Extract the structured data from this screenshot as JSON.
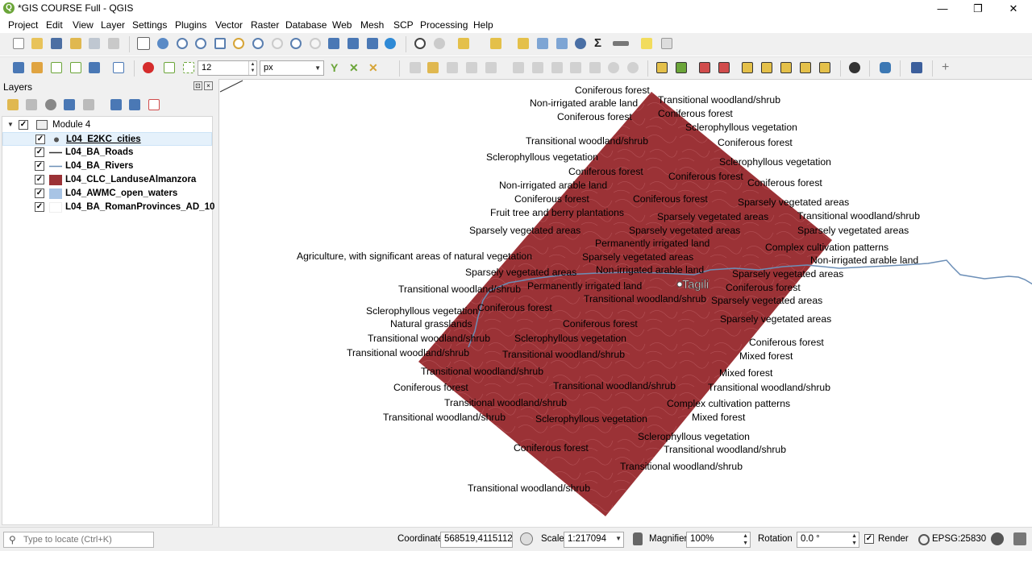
{
  "window": {
    "title": "*GIS COURSE Full - QGIS",
    "minimize": "—",
    "restore": "❐",
    "close": "✕"
  },
  "menu": [
    "Project",
    "Edit",
    "View",
    "Layer",
    "Settings",
    "Plugins",
    "Vector",
    "Raster",
    "Database",
    "Web",
    "Mesh",
    "SCP",
    "Processing",
    "Help"
  ],
  "toolbar2": {
    "symbol_size": "12",
    "unit": "px"
  },
  "layers_panel": {
    "title": "Layers",
    "group": "Module 4",
    "layers": [
      {
        "name": "L04_E2KC_cities",
        "symbol": "point"
      },
      {
        "name": "L04_BA_Roads",
        "symbol": "line-dark"
      },
      {
        "name": "L04_BA_Rivers",
        "symbol": "line-blue"
      },
      {
        "name": "L04_CLC_LanduseAlmanzora",
        "symbol": "fill-red"
      },
      {
        "name": "L04_AWMC_open_waters",
        "symbol": "fill-lightblue"
      },
      {
        "name": "L04_BA_RomanProvinces_AD_100",
        "symbol": "fill-empty"
      }
    ]
  },
  "colors": {
    "landuse_fill": "#9b3236",
    "river": "#6c8fb7",
    "qgis_green": "#6ba539"
  },
  "map": {
    "city_label": "Tagili",
    "labels": [
      "Coniferous forest",
      "Non-irrigated arable land",
      "Transitional woodland/shrub",
      "Coniferous forest",
      "Coniferous forest",
      "Sclerophyllous vegetation",
      "Transitional woodland/shrub",
      "Coniferous forest",
      "Sclerophyllous vegetation",
      "Sclerophyllous vegetation",
      "Coniferous forest",
      "Coniferous forest",
      "Non-irrigated arable land",
      "Coniferous forest",
      "Coniferous forest",
      "Coniferous forest",
      "Sparsely vegetated areas",
      "Fruit tree and berry plantations",
      "Sparsely vegetated areas",
      "Transitional woodland/shrub",
      "Sparsely vegetated areas",
      "Sparsely vegetated areas",
      "Sparsely vegetated areas",
      "Permanently irrigated land",
      "Complex cultivation patterns",
      "Agriculture, with significant areas of natural vegetation",
      "Sparsely vegetated areas",
      "Non-irrigated arable land",
      "Non-irrigated arable land",
      "Sparsely vegetated areas",
      "Sparsely vegetated areas",
      "Transitional woodland/shrub",
      "Permanently irrigated land",
      "Coniferous forest",
      "Transitional woodland/shrub",
      "Sparsely vegetated areas",
      "Sclerophyllous vegetation",
      "Coniferous forest",
      "Natural grasslands",
      "Coniferous forest",
      "Sparsely vegetated areas",
      "Transitional woodland/shrub",
      "Sclerophyllous vegetation",
      "Coniferous forest",
      "Transitional woodland/shrub",
      "Transitional woodland/shrub",
      "Mixed forest",
      "Transitional woodland/shrub",
      "Mixed forest",
      "Coniferous forest",
      "Transitional woodland/shrub",
      "Transitional woodland/shrub",
      "Transitional woodland/shrub",
      "Complex cultivation patterns",
      "Transitional woodland/shrub",
      "Sclerophyllous vegetation",
      "Mixed forest",
      "Sclerophyllous vegetation",
      "Coniferous forest",
      "Transitional woodland/shrub",
      "Transitional woodland/shrub",
      "Transitional woodland/shrub"
    ]
  },
  "statusbar": {
    "locate_placeholder": "Type to locate (Ctrl+K)",
    "coordinate_label": "Coordinate",
    "coordinate": "568519,4115112",
    "scale_label": "Scale",
    "scale": "1:217094",
    "magnifier_label": "Magnifier",
    "magnifier": "100%",
    "rotation_label": "Rotation",
    "rotation": "0.0 °",
    "render_label": "Render",
    "crs": "EPSG:25830"
  }
}
